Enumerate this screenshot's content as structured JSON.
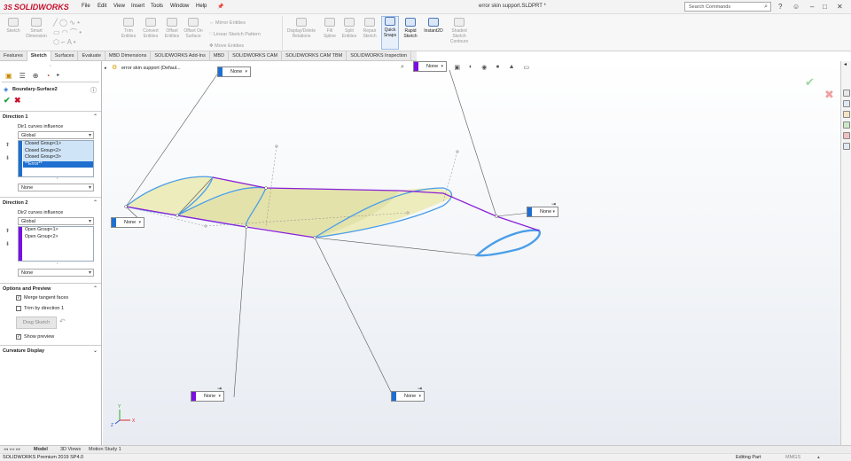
{
  "app": {
    "brand": "SOLIDWORKS",
    "document_title": "error skin support.SLDPRT *",
    "search_placeholder": "Search Commands",
    "menus": [
      "File",
      "Edit",
      "View",
      "Insert",
      "Tools",
      "Window",
      "Help"
    ]
  },
  "ribbon": {
    "buttons": [
      {
        "label": "Sketch",
        "enabled": false
      },
      {
        "label": "Smart Dimension",
        "enabled": false
      },
      {
        "label": "Trim Entities",
        "enabled": false
      },
      {
        "label": "Convert Entities",
        "enabled": false
      },
      {
        "label": "Offset Entities",
        "enabled": false
      },
      {
        "label": "Offset On Surface",
        "enabled": false
      },
      {
        "label": "Mirror Entities",
        "enabled": false
      },
      {
        "label": "Linear Sketch Pattern",
        "enabled": false
      },
      {
        "label": "Move Entities",
        "enabled": false
      },
      {
        "label": "Display/Delete Relations",
        "enabled": false
      },
      {
        "label": "Fill Spline",
        "enabled": false
      },
      {
        "label": "Split Entities",
        "enabled": false
      },
      {
        "label": "Repair Sketch",
        "enabled": false
      },
      {
        "label": "Quick Snaps",
        "enabled": true
      },
      {
        "label": "Rapid Sketch",
        "enabled": true
      },
      {
        "label": "Instant2D",
        "enabled": true
      },
      {
        "label": "Shaded Sketch Contours",
        "enabled": false
      }
    ]
  },
  "tabs": [
    "Features",
    "Sketch",
    "Surfaces",
    "Evaluate",
    "MBD Dimensions",
    "SOLIDWORKS Add-Ins",
    "MBD",
    "SOLIDWORKS CAM",
    "SOLIDWORKS CAM TBM",
    "SOLIDWORKS Inspection"
  ],
  "active_tab": "Sketch",
  "panel": {
    "feature_title": "Boundary-Surface2",
    "direction1": {
      "title": "Direction 1",
      "influence_label": "Dir1 curves influence",
      "influence_value": "Global",
      "items": [
        "Closed Group<1>",
        "Closed Group<2>",
        "Closed Group<3>",
        "**Error**"
      ],
      "tangency_value": "None",
      "color": "#1e6fd0"
    },
    "direction2": {
      "title": "Direction 2",
      "influence_label": "Dir2 curves influence",
      "influence_value": "Global",
      "items": [
        "Open Group<1>",
        "Open Group<2>"
      ],
      "tangency_value": "None",
      "color": "#7a10e0"
    },
    "options": {
      "title": "Options and Preview",
      "merge_tangent": "Merge tangent faces",
      "trim_dir1": "Trim by direction 1",
      "drag_sketch": "Drag Sketch",
      "show_preview": "Show preview"
    },
    "curvature_title": "Curvature Display"
  },
  "view": {
    "tree_item": "error skin support (Defaul...",
    "callouts": [
      {
        "value": "None",
        "color": "#1e6fd0"
      },
      {
        "value": "None",
        "color": "#7a10e0"
      },
      {
        "value": "None",
        "color": "#1e6fd0"
      },
      {
        "value": "None",
        "color": "#1e6fd0"
      },
      {
        "value": "None",
        "color": "#7a10e0"
      },
      {
        "value": "None",
        "color": "#1e6fd0"
      }
    ],
    "surface_color": "#ecebb8",
    "dir1_curve_color": "#4a9ee8",
    "dir2_curve_color": "#8a1fd8",
    "triad_labels": [
      "Y",
      "X",
      "Z"
    ]
  },
  "bottom_tabs": [
    "Model",
    "3D Views",
    "Motion Study 1"
  ],
  "status": {
    "product": "SOLIDWORKS Premium 2019 SP4.0",
    "mode": "Editing Part",
    "units": "MMGS"
  }
}
